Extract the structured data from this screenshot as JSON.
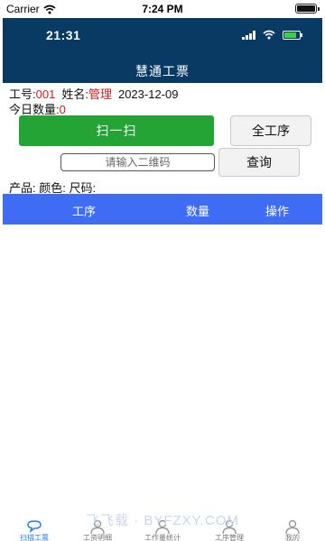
{
  "simulator": {
    "carrier": "Carrier",
    "time": "7:24 PM"
  },
  "status": {
    "time": "21:31"
  },
  "app": {
    "title": "慧通工票"
  },
  "info": {
    "job_no_label": "工号:",
    "job_no": "001",
    "name_label": "姓名:",
    "name": "管理",
    "date": "2023-12-09",
    "today_qty_label": "今日数量:",
    "today_qty": "0"
  },
  "actions": {
    "scan_label": "扫一扫",
    "all_process_label": "全工序",
    "qr_placeholder": "请输入二维码",
    "query_label": "查询"
  },
  "product_line": "产品: 颜色: 尺码:",
  "table": {
    "columns": [
      "工序",
      "数量",
      "操作"
    ],
    "rows": []
  },
  "watermark": "飞飞载 · BYFZXY.COM",
  "tabs": [
    {
      "label": "扫描工票",
      "icon": "chat-bubble-icon",
      "active": true
    },
    {
      "label": "工资明细",
      "icon": "user-icon"
    },
    {
      "label": "工作量统计",
      "icon": "user-icon"
    },
    {
      "label": "工序管理",
      "icon": "user-icon"
    },
    {
      "label": "我的",
      "icon": "user-icon"
    }
  ],
  "colors": {
    "header": "#083a63",
    "scan_button": "#23a434",
    "table_header": "#3f6cf5",
    "accent_red": "#d21e1e"
  }
}
